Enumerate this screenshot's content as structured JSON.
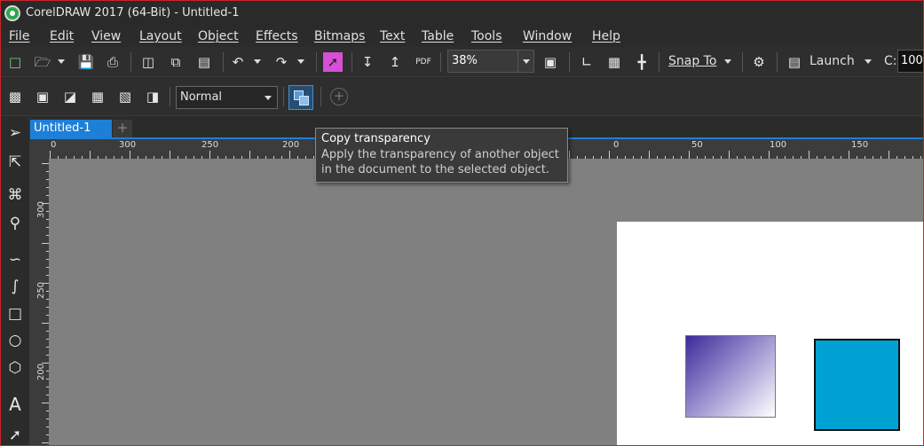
{
  "window": {
    "title": "CorelDRAW 2017 (64-Bit) - Untitled-1"
  },
  "menu": [
    "File",
    "Edit",
    "View",
    "Layout",
    "Object",
    "Effects",
    "Bitmaps",
    "Text",
    "Table",
    "Tools",
    "Window",
    "Help"
  ],
  "toolbar": {
    "zoom": "38%",
    "snap_label": "Snap To",
    "launch_label": "Launch",
    "c_label": "C:",
    "c_value": "100"
  },
  "property_bar": {
    "merge_mode": "Normal"
  },
  "tabs": [
    {
      "label": "Untitled-1",
      "active": true
    }
  ],
  "rulers": {
    "horizontal": [
      "0",
      "300",
      "250",
      "200",
      "0",
      "50",
      "100",
      "150"
    ],
    "vertical": [
      "300",
      "250",
      "200"
    ]
  },
  "tooltip": {
    "title": "Copy transparency",
    "line1": "Apply the transparency of another object",
    "line2": "in the document to the selected object."
  },
  "colors": {
    "accent": "#1e7fd6",
    "canvas": "#808080",
    "page": "#ffffff",
    "blue_square": "#00a2d4",
    "gradient_start": "#3e2a9a",
    "gradient_end": "#ffffff"
  }
}
